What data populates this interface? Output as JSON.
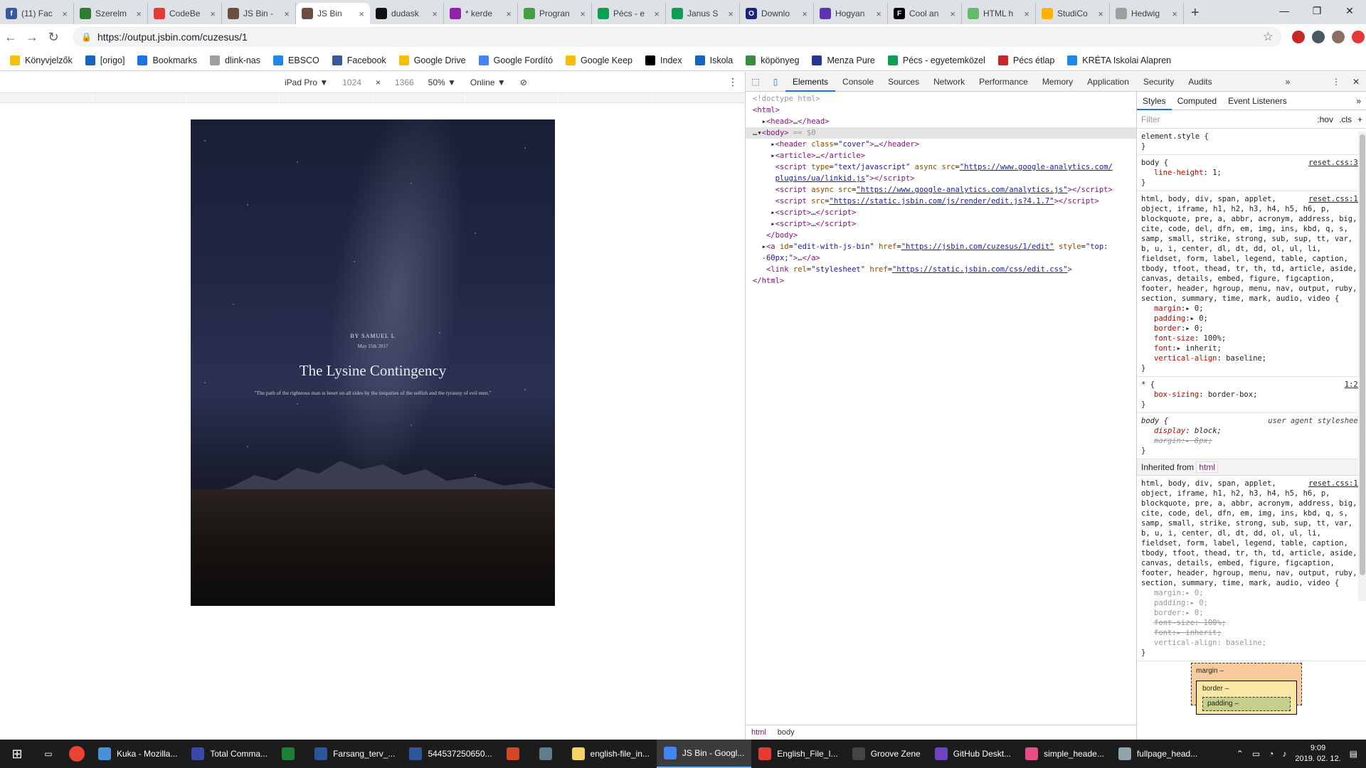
{
  "tabs": [
    {
      "title": "(11) Fac",
      "color": "#3b5998",
      "glyph": "f",
      "active": false
    },
    {
      "title": "Szerelm",
      "color": "#2e7d32",
      "glyph": "",
      "active": false
    },
    {
      "title": "CodeBe",
      "color": "#e53935",
      "glyph": "",
      "active": false
    },
    {
      "title": "JS Bin -",
      "color": "#6d4c41",
      "glyph": "",
      "active": false
    },
    {
      "title": "JS Bin",
      "color": "#6d4c41",
      "glyph": "",
      "active": true
    },
    {
      "title": "dudask",
      "color": "#111111",
      "glyph": "",
      "active": false
    },
    {
      "title": "* kerde",
      "color": "#8e24aa",
      "glyph": "",
      "active": false
    },
    {
      "title": "Progran",
      "color": "#43a047",
      "glyph": "",
      "active": false
    },
    {
      "title": "Pécs - e",
      "color": "#0f9d58",
      "glyph": "",
      "active": false
    },
    {
      "title": "Janus S",
      "color": "#0f9d58",
      "glyph": "",
      "active": false
    },
    {
      "title": "Downlo",
      "color": "#1a237e",
      "glyph": "O",
      "active": false
    },
    {
      "title": "Hogyan",
      "color": "#5e35b1",
      "glyph": "",
      "active": false
    },
    {
      "title": "Cool an",
      "color": "#000000",
      "glyph": "F",
      "active": false
    },
    {
      "title": "HTML h",
      "color": "#66bb6a",
      "glyph": "",
      "active": false
    },
    {
      "title": "StudiCo",
      "color": "#ffb300",
      "glyph": "",
      "active": false
    },
    {
      "title": "Hedwig",
      "color": "#9e9e9e",
      "glyph": "",
      "active": false
    }
  ],
  "address": {
    "url": "https://output.jsbin.com/cuzesus/1"
  },
  "bookmarks": [
    {
      "label": "Könyvjelzők",
      "color": "#f4c20d"
    },
    {
      "label": "[origo]",
      "color": "#1565c0"
    },
    {
      "label": "Bookmarks",
      "color": "#1a73e8"
    },
    {
      "label": "dlink-nas",
      "color": "#9e9e9e"
    },
    {
      "label": "EBSCO",
      "color": "#1e88e5"
    },
    {
      "label": "Facebook",
      "color": "#3b5998"
    },
    {
      "label": "Google Drive",
      "color": "#fbbc04"
    },
    {
      "label": "Google Fordító",
      "color": "#4285f4"
    },
    {
      "label": "Google Keep",
      "color": "#fbbc04"
    },
    {
      "label": "Index",
      "color": "#000000"
    },
    {
      "label": "Iskola",
      "color": "#1565c0"
    },
    {
      "label": "köpönyeg",
      "color": "#388e3c"
    },
    {
      "label": "Menza Pure",
      "color": "#283593"
    },
    {
      "label": "Pécs - egyetemközel",
      "color": "#0f9d58"
    },
    {
      "label": "Pécs étlap",
      "color": "#c62828"
    },
    {
      "label": "KRÉTA Iskolai Alapren",
      "color": "#1e88e5"
    }
  ],
  "device_toolbar": {
    "device": "iPad Pro ▼",
    "width": "1024",
    "x": "×",
    "height": "1366",
    "zoom": "50% ▼",
    "network": "Online ▼"
  },
  "cover": {
    "by": "BY SAMUEL L",
    "date": "May 15th 2017",
    "title": "The Lysine Contingency",
    "quote": "\"The path of the righteous man is beset on all sides by the iniquities of the selfish and the tyranny of evil men.\""
  },
  "devtools": {
    "tabs": [
      "Elements",
      "Console",
      "Sources",
      "Network",
      "Performance",
      "Memory",
      "Application",
      "Security",
      "Audits"
    ],
    "active_tab": "Elements",
    "breadcrumbs": [
      "html",
      "body"
    ]
  },
  "styles_panel": {
    "tabs": [
      "Styles",
      "Computed",
      "Event Listeners"
    ],
    "filter_placeholder": "Filter",
    "hov": ":hov",
    "cls": ".cls",
    "inherited_label": "Inherited from",
    "inherited_tag": "html",
    "boxmodel": {
      "margin": "margin",
      "border": "border",
      "padding": "padding",
      "dash": "–"
    }
  },
  "taskbar": {
    "items": [
      {
        "label": "Kuka - Mozilla...",
        "color": "#4a90d9",
        "active": false
      },
      {
        "label": "Total Comma...",
        "color": "#3949ab",
        "active": false
      },
      {
        "label": "",
        "color": "#1e7e34",
        "active": false
      },
      {
        "label": "Farsang_terv_...",
        "color": "#2b579a",
        "active": false
      },
      {
        "label": "544537250650...",
        "color": "#2b579a",
        "active": false
      },
      {
        "label": "",
        "color": "#d24726",
        "active": false
      },
      {
        "label": "",
        "color": "#607d8b",
        "active": false
      },
      {
        "label": "english-file_in...",
        "color": "#f6d365",
        "active": false
      },
      {
        "label": "JS Bin - Googl...",
        "color": "#4285f4",
        "active": true
      },
      {
        "label": "English_File_I...",
        "color": "#e53935",
        "active": false
      },
      {
        "label": "Groove Zene",
        "color": "#444444",
        "active": false
      },
      {
        "label": "GitHub Deskt...",
        "color": "#6f42c1",
        "active": false
      },
      {
        "label": "simple_heade...",
        "color": "#ea4c89",
        "active": false
      },
      {
        "label": "fullpage_head...",
        "color": "#90a4ae",
        "active": false
      }
    ],
    "time": "9:09",
    "date": "2019. 02. 12."
  }
}
